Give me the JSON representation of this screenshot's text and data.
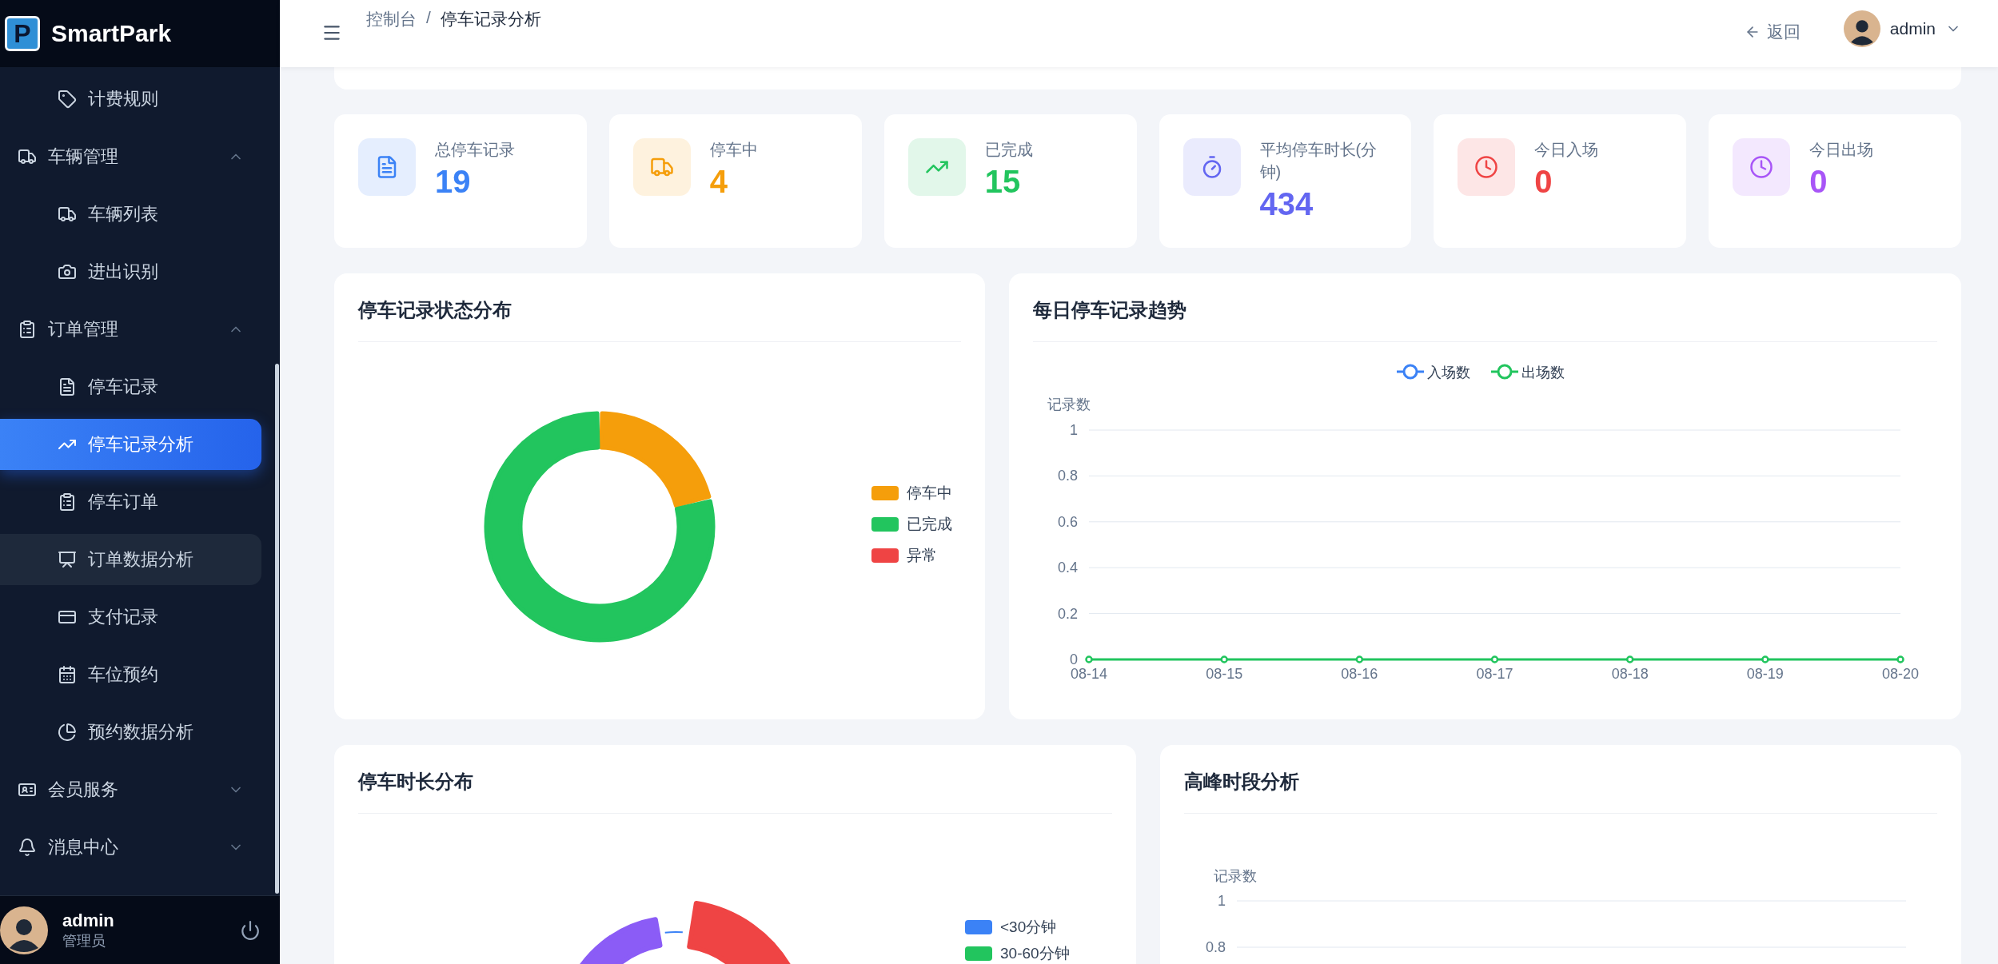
{
  "sidebar": {
    "logo_letter": "P",
    "brand": "SmartPark",
    "menu": [
      {
        "kind": "item",
        "label": "计费规则",
        "selected": false,
        "hovered": false
      },
      {
        "kind": "group",
        "label": "车辆管理",
        "expanded": true,
        "children": [
          {
            "label": "车辆列表",
            "selected": false,
            "hovered": false
          },
          {
            "label": "进出识别",
            "selected": false,
            "hovered": false
          }
        ]
      },
      {
        "kind": "group",
        "label": "订单管理",
        "expanded": true,
        "children": [
          {
            "label": "停车记录",
            "selected": false,
            "hovered": false
          },
          {
            "label": "停车记录分析",
            "selected": true,
            "hovered": false
          },
          {
            "label": "停车订单",
            "selected": false,
            "hovered": false
          },
          {
            "label": "订单数据分析",
            "selected": false,
            "hovered": true
          },
          {
            "label": "支付记录",
            "selected": false,
            "hovered": false
          },
          {
            "label": "车位预约",
            "selected": false,
            "hovered": false
          },
          {
            "label": "预约数据分析",
            "selected": false,
            "hovered": false
          }
        ]
      },
      {
        "kind": "group",
        "label": "会员服务",
        "expanded": false
      },
      {
        "kind": "group",
        "label": "消息中心",
        "expanded": false
      }
    ],
    "user": {
      "name": "admin",
      "role": "管理员"
    }
  },
  "header": {
    "breadcrumb": [
      "控制台",
      "停车记录分析"
    ],
    "separator": "/",
    "back": "返回",
    "user": "admin"
  },
  "stats": [
    {
      "label": "总停车记录",
      "value": "19",
      "color": "#3b82f6"
    },
    {
      "label": "停车中",
      "value": "4",
      "color": "#f59e0b"
    },
    {
      "label": "已完成",
      "value": "15",
      "color": "#22c55e"
    },
    {
      "label": "平均停车时长(分钟)",
      "value": "434",
      "color": "#6366f1"
    },
    {
      "label": "今日入场",
      "value": "0",
      "color": "#ef4444"
    },
    {
      "label": "今日出场",
      "value": "0",
      "color": "#a855f7"
    }
  ],
  "status_chart": {
    "title": "停车记录状态分布",
    "chart_data": {
      "type": "donut",
      "categories": [
        "停车中",
        "已完成",
        "异常"
      ],
      "values": [
        21.05,
        78.95,
        0
      ],
      "colors": [
        "#f59e0b",
        "#22c55e",
        "#ef4444"
      ],
      "legend": "right"
    }
  },
  "trend_chart": {
    "title": "每日停车记录趋势",
    "chart_data": {
      "type": "line",
      "ylabel": "记录数",
      "categories": [
        "08-14",
        "08-15",
        "08-16",
        "08-17",
        "08-18",
        "08-19",
        "08-20"
      ],
      "series": [
        {
          "name": "入场数",
          "color": "#3b82f6",
          "marker": "circle",
          "values": [
            null,
            null,
            null,
            null,
            null,
            null,
            null
          ]
        },
        {
          "name": "出场数",
          "color": "#22c55e",
          "marker": "circle",
          "values": [
            0,
            0,
            0,
            0,
            0,
            0,
            0
          ]
        }
      ],
      "ylim": [
        0,
        1
      ],
      "yticks": [
        0,
        0.2,
        0.4,
        0.6,
        0.8,
        1
      ],
      "grid": true,
      "legend": "top"
    }
  },
  "duration_chart": {
    "title": "停车时长分布",
    "legend": [
      {
        "label": "<30分钟",
        "color": "#3b82f6"
      },
      {
        "label": "30-60分钟",
        "color": "#22c55e"
      }
    ]
  },
  "peak_chart": {
    "title": "高峰时段分析",
    "ylabel": "记录数",
    "ticks": [
      "1",
      "0.8"
    ]
  }
}
